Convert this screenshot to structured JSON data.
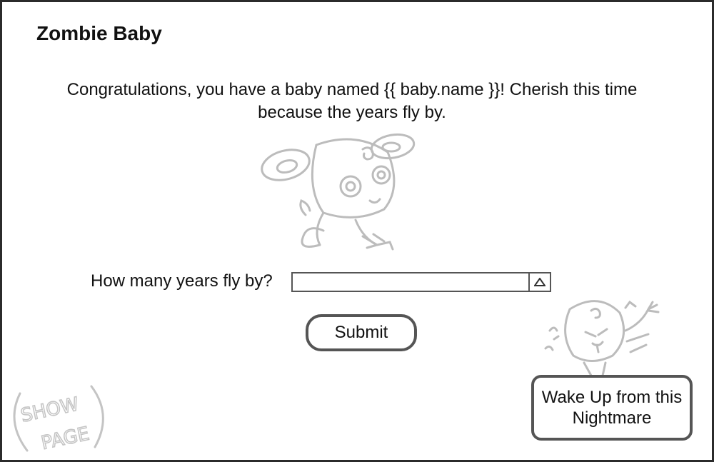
{
  "app": {
    "title": "Zombie Baby"
  },
  "intro": {
    "message": "Congratulations, you have a baby named {{ baby.name }}!  Cherish this time because the years fly by."
  },
  "form": {
    "question_label": "How many years fly by?",
    "years_value": "",
    "submit_label": "Submit"
  },
  "actions": {
    "wake_label": "Wake Up from this Nightmare"
  },
  "stamp": {
    "text": "SHOW PAGE"
  },
  "colors": {
    "border": "#2b2b2b",
    "sketch": "#bdbdbd",
    "button_border": "#555555"
  },
  "icons": {
    "stepper": "triangle-up-icon"
  }
}
